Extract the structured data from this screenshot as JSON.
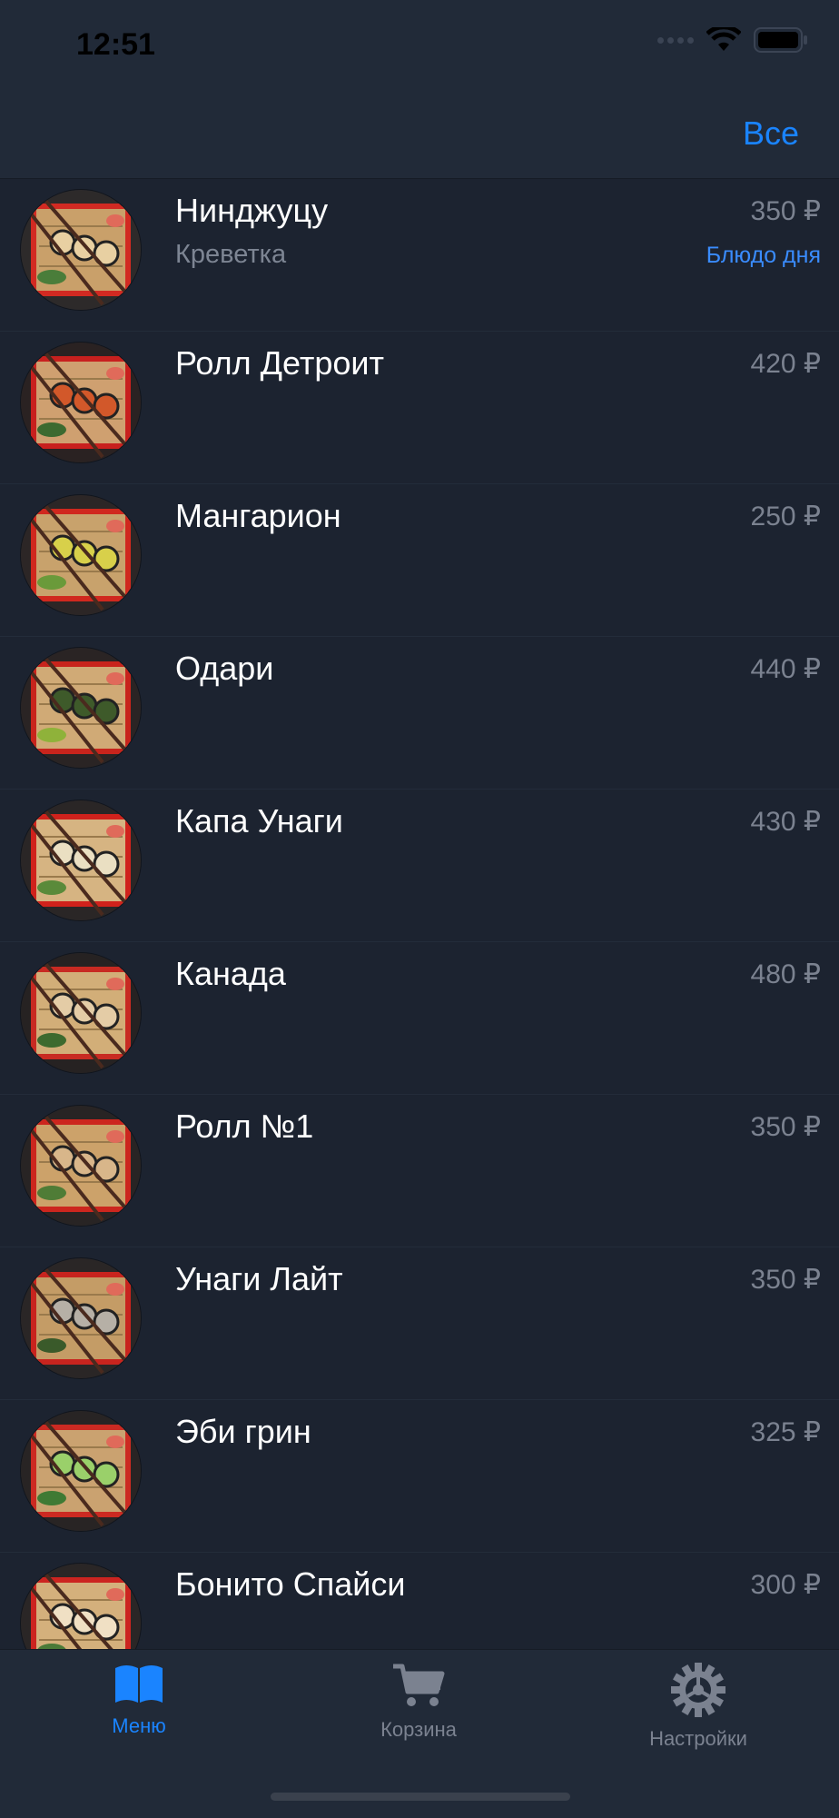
{
  "status_bar": {
    "time": "12:51"
  },
  "nav": {
    "right_button": "Все"
  },
  "menu_items": [
    {
      "name": "Нинджуцу",
      "description": "Креветка",
      "price": "350 ₽",
      "badge": "Блюдо дня"
    },
    {
      "name": "Ролл Детроит",
      "description": "",
      "price": "420 ₽",
      "badge": ""
    },
    {
      "name": "Мангарион",
      "description": "",
      "price": "250 ₽",
      "badge": ""
    },
    {
      "name": "Одари",
      "description": "",
      "price": "440 ₽",
      "badge": ""
    },
    {
      "name": "Капа Унаги",
      "description": "",
      "price": "430 ₽",
      "badge": ""
    },
    {
      "name": "Канада",
      "description": "",
      "price": "480 ₽",
      "badge": ""
    },
    {
      "name": "Ролл №1",
      "description": "",
      "price": "350 ₽",
      "badge": ""
    },
    {
      "name": "Унаги Лайт",
      "description": "",
      "price": "350 ₽",
      "badge": ""
    },
    {
      "name": "Эби грин",
      "description": "",
      "price": "325 ₽",
      "badge": ""
    },
    {
      "name": "Бонито Спайси",
      "description": "",
      "price": "300 ₽",
      "badge": ""
    }
  ],
  "tabs": [
    {
      "label": "Меню",
      "icon": "book-icon",
      "active": true
    },
    {
      "label": "Корзина",
      "icon": "cart-icon",
      "active": false
    },
    {
      "label": "Настройки",
      "icon": "gear-icon",
      "active": false
    }
  ],
  "colors": {
    "background": "#1c2330",
    "bar": "#212a38",
    "accent": "#1a84ff",
    "price": "#7b8290",
    "inactive_tab": "#7b8290"
  }
}
